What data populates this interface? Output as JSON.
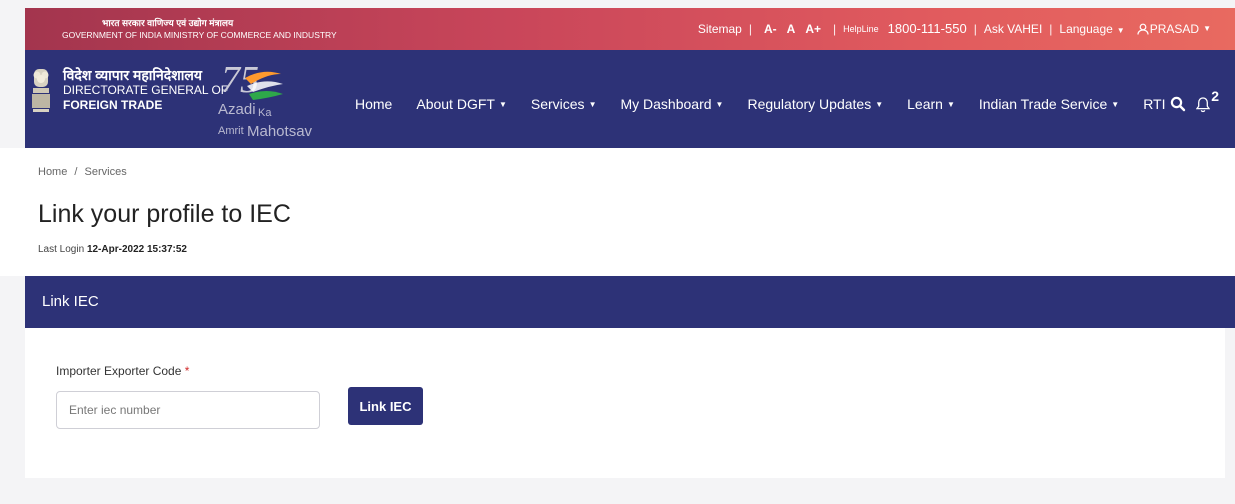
{
  "topbar": {
    "gov_hindi": "भारत सरकार  वाणिज्य एवं उद्योग मंत्रालय",
    "gov_english": "GOVERNMENT OF INDIA  MINISTRY OF COMMERCE AND INDUSTRY",
    "sitemap": "Sitemap",
    "font_small": "A-",
    "font_normal": "A",
    "font_large": "A+",
    "helpline_label": "HelpLine",
    "helpline_number": "1800-111-550",
    "ask_vahei": "Ask VAHEI",
    "language": "Language",
    "user": "PRASAD"
  },
  "brand": {
    "hindi": "विदेश व्यापार महानिदेशालय",
    "english_line1": "DIRECTORATE GENERAL OF",
    "english_line2": "FOREIGN TRADE",
    "aka_number": "75",
    "aka_azadi": "Azadi",
    "aka_ka": "Ka",
    "aka_amrit": "Amrit",
    "aka_mahotsav": "Mahotsav"
  },
  "nav": {
    "home": "Home",
    "about": "About DGFT",
    "services": "Services",
    "dashboard": "My Dashboard",
    "regulatory": "Regulatory Updates",
    "learn": "Learn",
    "its": "Indian Trade Service",
    "rti": "RTI",
    "notification_count": "2"
  },
  "breadcrumb": {
    "home": "Home",
    "separator": "/",
    "current": "Services"
  },
  "page": {
    "title": "Link your profile to IEC",
    "last_login_label": "Last Login",
    "last_login_value": "12-Apr-2022 15:37:52"
  },
  "panel": {
    "heading": "Link IEC",
    "field_label": "Importer Exporter Code",
    "required_mark": "*",
    "input_placeholder": "Enter iec number",
    "input_value": "",
    "button_label": "Link IEC"
  },
  "colors": {
    "navy": "#2d3277",
    "topbar_start": "#a3354e",
    "topbar_end": "#e86a60",
    "required": "#d12b2b"
  }
}
